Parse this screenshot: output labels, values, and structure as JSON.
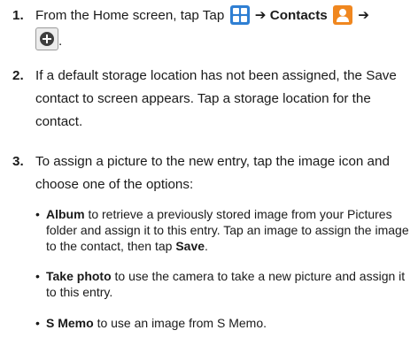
{
  "step1": {
    "number": "1.",
    "text_before": "From the Home screen, tap Tap",
    "arrow1": "➔",
    "contacts_label": "Contacts",
    "arrow2": "➔",
    "end": "."
  },
  "step2": {
    "number": "2.",
    "text": "If a default storage location has not been assigned, the Save contact to screen appears. Tap a storage location for the contact."
  },
  "step3": {
    "number": "3.",
    "text": "To assign a picture to the new entry, tap the image icon and choose one of the options:"
  },
  "options": [
    {
      "bullet": "•",
      "label": "Album",
      "text_a": " to retrieve a previously stored image from your Pictures folder and assign it to this entry. Tap an image to assign the image to the contact, then tap ",
      "bold_end": "Save",
      "text_b": "."
    },
    {
      "bullet": "•",
      "label": "Take photo",
      "text_a": " to use the camera to take a new picture and assign it to this entry.",
      "bold_end": "",
      "text_b": ""
    },
    {
      "bullet": "•",
      "label": "S Memo",
      "text_a": " to use an image from S Memo.",
      "bold_end": "",
      "text_b": ""
    }
  ],
  "icons": {
    "apps": "apps-grid-icon",
    "contacts": "contacts-person-icon",
    "add": "add-circle-icon"
  },
  "colors": {
    "apps_icon": "#2f7fd3",
    "contacts_icon": "#f0871f",
    "add_icon": "#3d3d3d"
  }
}
